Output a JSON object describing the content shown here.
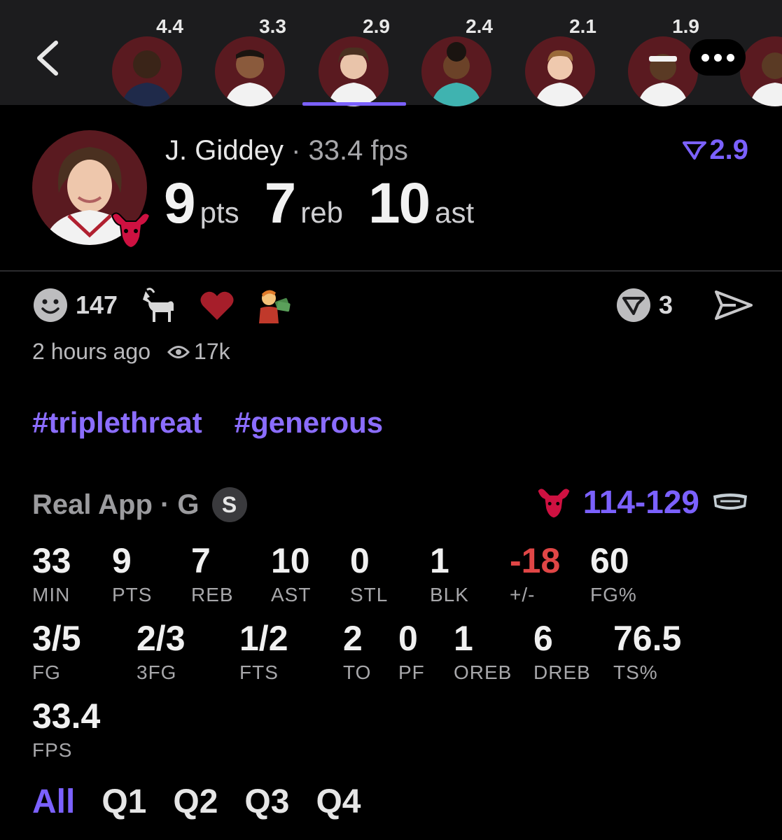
{
  "strip": {
    "players": [
      {
        "score": "4.4",
        "jersey": "navy"
      },
      {
        "score": "3.3",
        "jersey": "white"
      },
      {
        "score": "2.9",
        "jersey": "white"
      },
      {
        "score": "2.4",
        "jersey": "teal"
      },
      {
        "score": "2.1",
        "jersey": "white"
      },
      {
        "score": "1.9",
        "jersey": "white"
      },
      {
        "score": "",
        "jersey": "white"
      }
    ],
    "selected_index": 2
  },
  "player": {
    "name": "J. Giddey",
    "fps_text": " · 33.4 fps",
    "rank_value": "2.9",
    "pts": "9",
    "pts_unit": "pts",
    "reb": "7",
    "reb_unit": "reb",
    "ast": "10",
    "ast_unit": "ast"
  },
  "reactions": {
    "smile_count": "147",
    "icons": [
      "goat-icon",
      "heart-icon",
      "money-fan-icon"
    ],
    "share_count": "3"
  },
  "meta": {
    "time": "2 hours ago",
    "views": "17k"
  },
  "hashtags": [
    "#triplethreat",
    "#generous"
  ],
  "game": {
    "label": "Real App · G",
    "badge": "S",
    "score": "114-129"
  },
  "stats_row1": [
    {
      "value": "33",
      "label": "MIN"
    },
    {
      "value": "9",
      "label": "PTS"
    },
    {
      "value": "7",
      "label": "REB"
    },
    {
      "value": "10",
      "label": "AST"
    },
    {
      "value": "0",
      "label": "STL"
    },
    {
      "value": "1",
      "label": "BLK"
    },
    {
      "value": "-18",
      "label": "+/-"
    },
    {
      "value": "60",
      "label": "FG%"
    }
  ],
  "stats_row2": [
    {
      "value": "3/5",
      "label": "FG"
    },
    {
      "value": "2/3",
      "label": "3FG"
    },
    {
      "value": "1/2",
      "label": "FTS"
    },
    {
      "value": "2",
      "label": "TO"
    },
    {
      "value": "0",
      "label": "PF"
    },
    {
      "value": "1",
      "label": "OREB"
    },
    {
      "value": "6",
      "label": "DREB"
    },
    {
      "value": "76.5",
      "label": "TS%"
    }
  ],
  "stats_row3": [
    {
      "value": "33.4",
      "label": "FPS"
    }
  ],
  "quarters": [
    "All",
    "Q1",
    "Q2",
    "Q3",
    "Q4"
  ],
  "colors": {
    "accent": "#7b61ff",
    "negative": "#e04646",
    "team_bg": "#5a1a20"
  }
}
